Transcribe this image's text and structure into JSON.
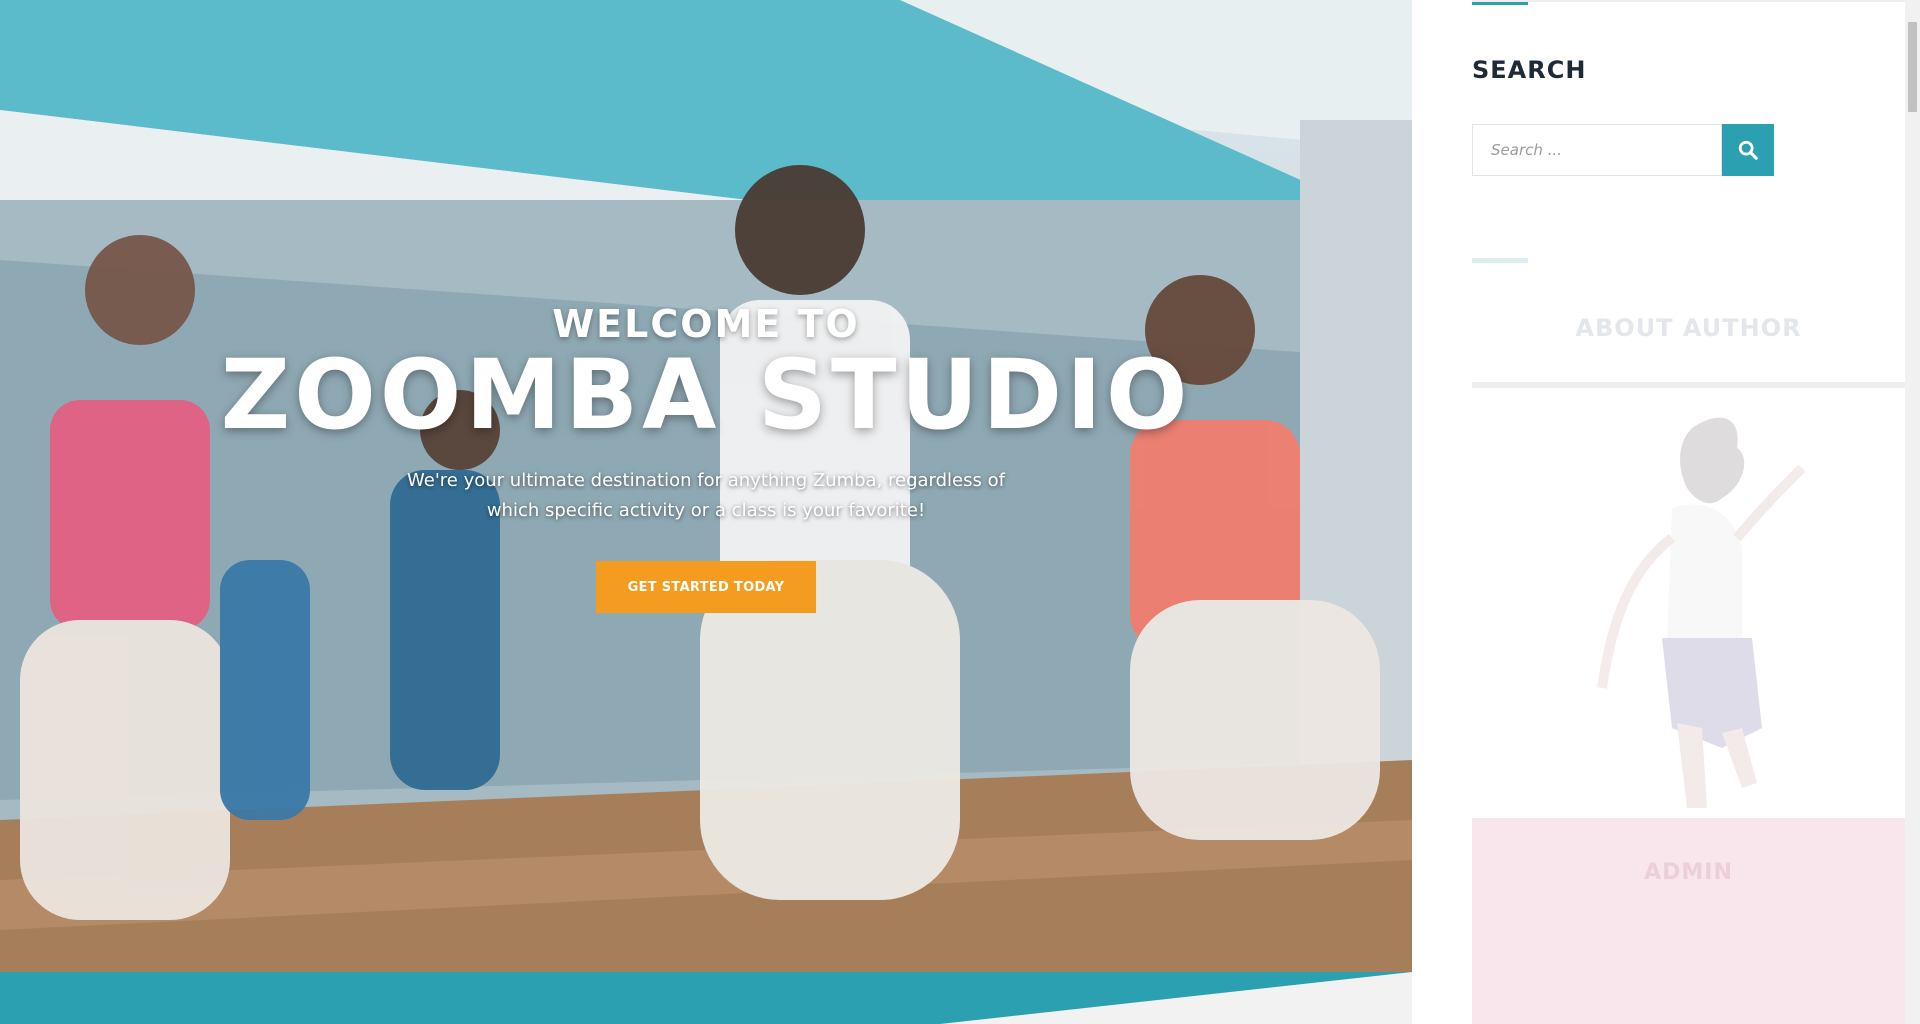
{
  "hero": {
    "welcome": "WELCOME TO",
    "title": "ZOOMBA STUDIO",
    "subtitle": "We're your ultimate destination for anything Zumba, regardless of which specific activity or a class is your favorite!",
    "cta_label": "GET STARTED TODAY"
  },
  "sidebar": {
    "search": {
      "title": "SEARCH",
      "placeholder": "Search ...",
      "button_icon": "search-icon"
    },
    "about": {
      "title": "ABOUT AUTHOR",
      "photo_icon": "dancer-photo",
      "author_name": "ADMIN"
    }
  },
  "colors": {
    "accent": "#2aa0b0",
    "cta": "#f39c1f",
    "heading": "#1f2a36",
    "author_card": "#f8e6ec"
  }
}
